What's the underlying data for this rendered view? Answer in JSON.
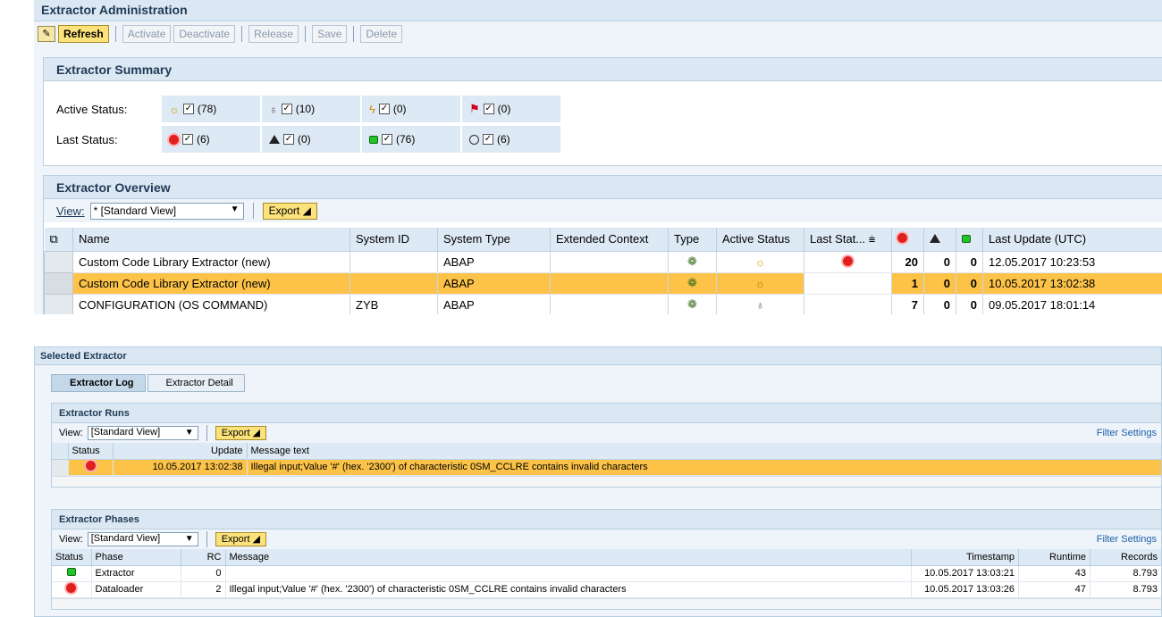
{
  "admin": {
    "title": "Extractor Administration",
    "toolbar": {
      "refresh": "Refresh",
      "activate": "Activate",
      "deactivate": "Deactivate",
      "release": "Release",
      "save": "Save",
      "delete": "Delete"
    }
  },
  "summary": {
    "title": "Extractor Summary",
    "active_label": "Active Status:",
    "last_label": "Last Status:",
    "active": [
      {
        "icon": "lightbulb-on-icon",
        "count": "(78)"
      },
      {
        "icon": "lightbulb-off-icon",
        "count": "(10)"
      },
      {
        "icon": "lightning-icon",
        "count": "(0)"
      },
      {
        "icon": "red-flag-icon",
        "count": "(0)"
      }
    ],
    "last": [
      {
        "icon": "red-status-icon",
        "count": "(6)"
      },
      {
        "icon": "warning-triangle-icon",
        "count": "(0)"
      },
      {
        "icon": "green-status-icon",
        "count": "(76)"
      },
      {
        "icon": "empty-status-icon",
        "count": "(6)"
      }
    ]
  },
  "overview": {
    "title": "Extractor Overview",
    "view_label": "View:",
    "view_value": "* [Standard View]",
    "export": "Export",
    "columns": [
      "Name",
      "System ID",
      "System Type",
      "Extended Context",
      "Type",
      "Active Status",
      "Last Stat...",
      "",
      "",
      "",
      "Last Update (UTC)"
    ],
    "rows": [
      {
        "name": "Custom Code Library Extractor (new)",
        "system_id": "",
        "system_type": "ABAP",
        "ext": "",
        "red": "20",
        "yellow": "0",
        "green": "0",
        "updated": "12.05.2017 10:23:53"
      },
      {
        "name": "Custom Code Library Extractor (new)",
        "system_id": "",
        "system_type": "ABAP",
        "ext": "",
        "red": "1",
        "yellow": "0",
        "green": "0",
        "updated": "10.05.2017 13:02:38"
      },
      {
        "name": "CONFIGURATION (OS COMMAND)",
        "system_id": "ZYB",
        "system_type": "ABAP",
        "ext": "",
        "red": "7",
        "yellow": "0",
        "green": "0",
        "updated": "09.05.2017 18:01:14"
      }
    ]
  },
  "selected": {
    "title": "Selected Extractor",
    "tabs": [
      "Extractor Log",
      "Extractor Detail"
    ],
    "runs": {
      "title": "Extractor Runs",
      "view_label": "View:",
      "view_value": "[Standard View]",
      "export": "Export",
      "filter": "Filter Settings",
      "columns": [
        "Status",
        "Update",
        "Message text"
      ],
      "rows": [
        {
          "update": "10.05.2017 13:02:38",
          "message": "Illegal input;Value '#' (hex. '2300') of characteristic 0SM_CCLRE contains invalid characters"
        }
      ]
    },
    "phases": {
      "title": "Extractor Phases",
      "view_label": "View:",
      "view_value": "[Standard View]",
      "export": "Export",
      "filter": "Filter Settings",
      "columns": [
        "Status",
        "Phase",
        "RC",
        "Message",
        "Timestamp",
        "Runtime",
        "Records"
      ],
      "rows": [
        {
          "phase": "Extractor",
          "rc": "0",
          "message": "",
          "timestamp": "10.05.2017 13:03:21",
          "runtime": "43",
          "records": "8.793"
        },
        {
          "phase": "Dataloader",
          "rc": "2",
          "message": "Illegal input;Value '#' (hex. '2300') of characteristic 0SM_CCLRE contains invalid characters",
          "timestamp": "10.05.2017 13:03:26",
          "runtime": "47",
          "records": "8.793"
        }
      ]
    }
  }
}
